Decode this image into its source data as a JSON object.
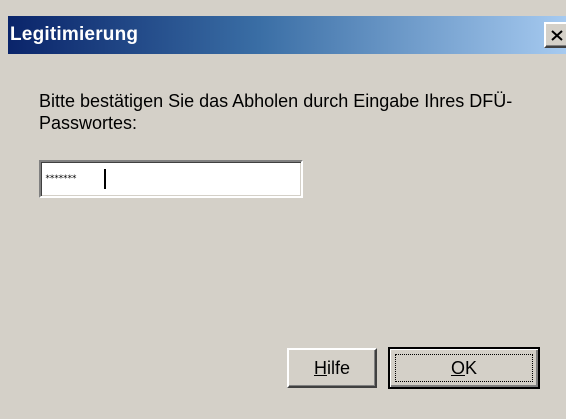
{
  "window": {
    "title": "Legitimierung"
  },
  "dialog": {
    "prompt": "Bitte bestätigen Sie das Abholen durch Eingabe Ihres DFÜ-Passwortes:",
    "password_field": {
      "value": "*******"
    }
  },
  "buttons": {
    "help": {
      "mnemonic": "H",
      "rest": "ilfe"
    },
    "ok": {
      "mnemonic": "O",
      "rest": "K"
    }
  },
  "icons": {
    "close": "close-icon"
  },
  "colors": {
    "dialog_background": "#d4d0c8",
    "titlebar_start": "#0a246a",
    "titlebar_end": "#a6caf0",
    "title_text": "#ffffff"
  }
}
